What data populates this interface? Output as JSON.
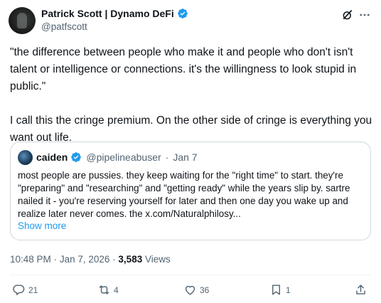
{
  "author": {
    "name": "Patrick Scott | Dynamo DeFi",
    "handle": "@patfscott"
  },
  "post": {
    "text": "\"the difference between people who make it and people who don't isn't talent or intelligence or connections. it's the willingness to look stupid in public.\"\n\nI call this the cringe premium. On the other side of cringe is everything you want out life."
  },
  "quote": {
    "name": "caiden",
    "handle": "@pipelineabuser",
    "separator": "·",
    "date": "Jan 7",
    "text": "most people are pussies. they keep waiting for the \"right time\" to start. they're \"preparing\" and \"researching\" and \"getting ready\" while the years slip by. sartre nailed it - you're reserving yourself for later and then one day you wake up and realize later never comes. the x.com/Naturalphilosy...",
    "show_more": "Show more"
  },
  "meta": {
    "time": "10:48 PM",
    "separator": "·",
    "date": "Jan 7, 2026",
    "views_count": "3,583",
    "views_label": "Views"
  },
  "actions": {
    "replies": "21",
    "reposts": "4",
    "likes": "36",
    "bookmarks": "1"
  },
  "colors": {
    "accent": "#1d9bf0",
    "text": "#0f1419",
    "secondary": "#536471",
    "border": "#cfd9de"
  },
  "icons": [
    "verified-badge-icon",
    "grok-icon",
    "more-icon",
    "reply-icon",
    "repost-icon",
    "like-icon",
    "bookmark-icon",
    "share-icon"
  ]
}
